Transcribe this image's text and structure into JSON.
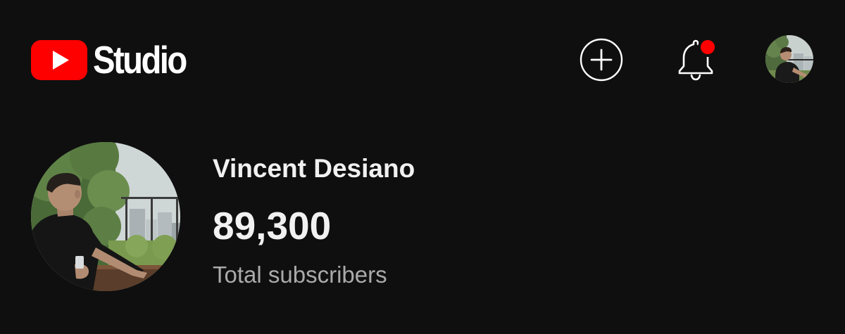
{
  "header": {
    "app_name": "Studio",
    "icons": {
      "logo": "youtube-play-logo",
      "create": "plus-circle-icon",
      "notifications": "bell-icon",
      "account": "profile-avatar"
    },
    "notification_dot": true
  },
  "channel": {
    "name": "Vincent Desiano",
    "subscriber_count": "89,300",
    "subscriber_label": "Total subscribers"
  },
  "colors": {
    "background": "#0f0f0f",
    "brand_red": "#ff0000",
    "primary_text": "#f1f1f1",
    "secondary_text": "#aaaaaa"
  }
}
